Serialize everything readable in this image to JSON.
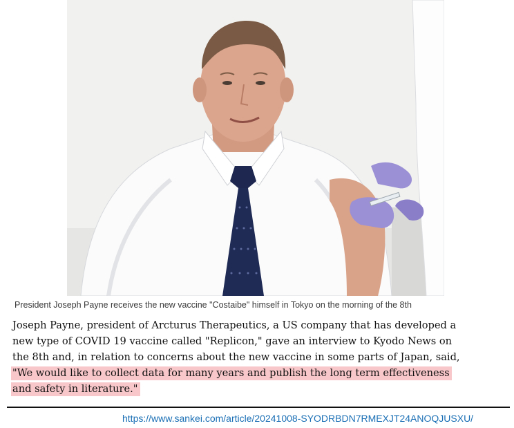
{
  "photo": {
    "alt": "President Joseph Payne receiving a vaccine injection in his upper arm"
  },
  "caption": "President Joseph Payne receives the new vaccine \"Costaibe\" himself in Tokyo on the morning of the 8th",
  "article": {
    "lines": [
      "Joseph Payne, president of Arcturus Therapeutics, a US company that has developed a",
      "new type of COVID 19 vaccine called \"Replicon,\" gave an interview to Kyodo News on",
      "the 8th and, in relation to concerns about the new vaccine in some parts of Japan, said,"
    ],
    "highlighted_lines": [
      "\"We would like to collect data for many years and publish the long term effectiveness",
      "and safety in literature.\""
    ]
  },
  "source_url": "https://www.sankei.com/article/20241008-SYODRBDN7RMEXJT24ANOQJUSXU/",
  "colors": {
    "highlight": "#f8c7c9",
    "link": "#1a6fb5"
  }
}
